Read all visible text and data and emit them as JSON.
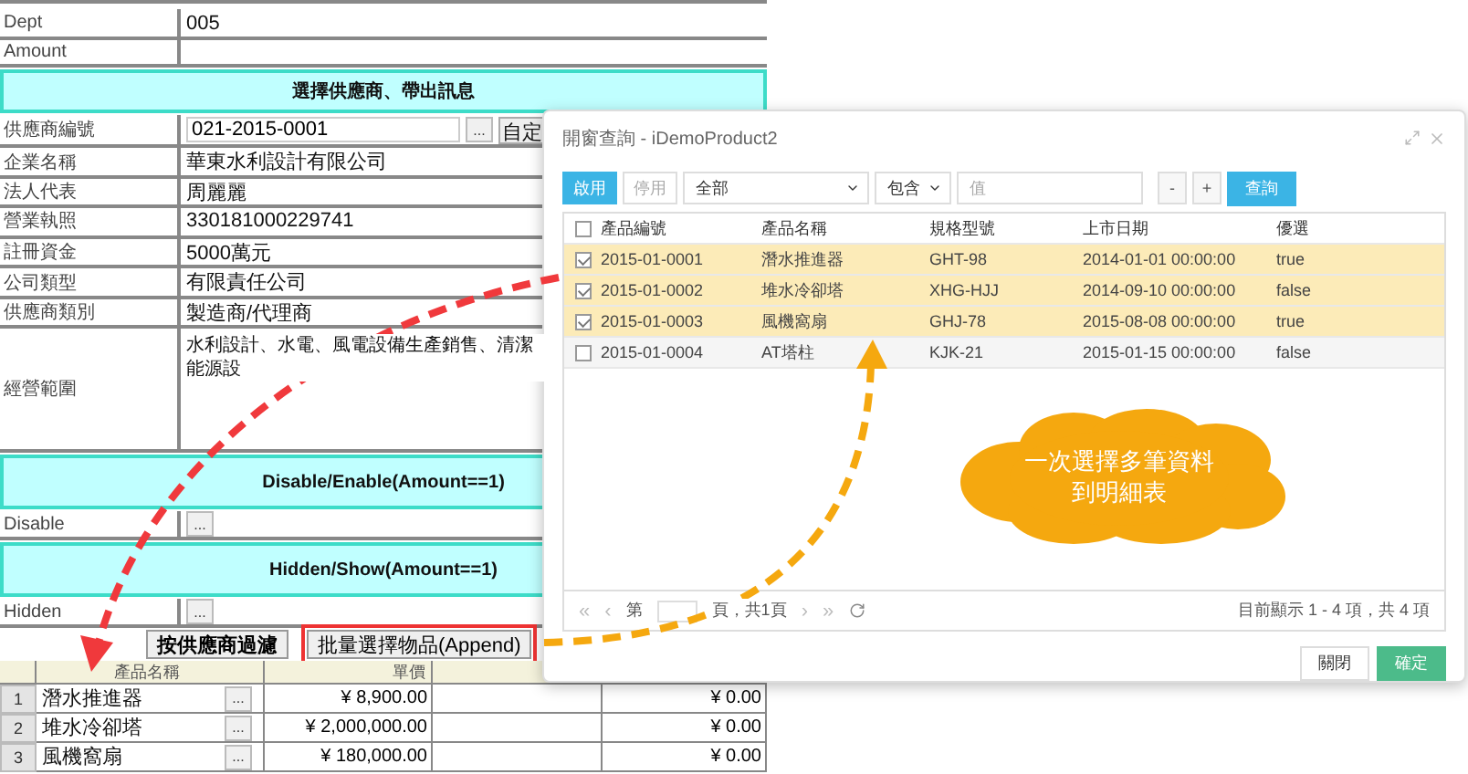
{
  "form": {
    "rows": [
      {
        "kind": "field",
        "label": "Dept",
        "value": "005"
      },
      {
        "kind": "field",
        "label": "Amount"
      },
      {
        "kind": "header",
        "title": "選擇供應商、帶出訊息"
      },
      {
        "kind": "lookup",
        "label": "供應商編號",
        "value": "021-2015-0001",
        "button": "...",
        "action": "自定"
      },
      {
        "kind": "field",
        "label": "企業名稱",
        "value": "華東水利設計有限公司"
      },
      {
        "kind": "field",
        "label": "法人代表",
        "value": "周麗麗"
      },
      {
        "kind": "field",
        "label": "營業執照",
        "value": "330181000229741"
      },
      {
        "kind": "field",
        "label": "註冊資金",
        "value": "5000萬元"
      },
      {
        "kind": "field",
        "label": "公司類型",
        "value": "有限責任公司"
      },
      {
        "kind": "field",
        "label": "供應商類別",
        "value": "製造商/代理商"
      },
      {
        "kind": "multiline",
        "label": "經營範圍",
        "value": "水利設計、水電、風電設備生產銷售、清潔能源設"
      },
      {
        "kind": "header",
        "title": "Disable/Enable(Amount==1)"
      },
      {
        "kind": "button_field",
        "label": "Disable",
        "button": "..."
      },
      {
        "kind": "header",
        "title": "Hidden/Show(Amount==1)"
      },
      {
        "kind": "button_field",
        "label": "Hidden",
        "button": "..."
      }
    ],
    "actions": [
      {
        "label": "按供應商過濾",
        "highlighted": false
      },
      {
        "label": "批量選擇物品(Append)",
        "highlighted": true
      }
    ]
  },
  "detail_grid": {
    "columns": [
      "產品名稱",
      "單價"
    ],
    "rows": [
      {
        "no": "1",
        "name": "潛水推進器",
        "button": "...",
        "price": "¥ 8,900.00",
        "column_4": "¥ 0.00"
      },
      {
        "no": "2",
        "name": "堆水冷卻塔",
        "button": "...",
        "price": "¥ 2,000,000.00",
        "column_4": "¥ 0.00"
      },
      {
        "no": "3",
        "name": "風機窩扇",
        "button": "...",
        "price": "¥ 180,000.00",
        "column_4": "¥ 0.00"
      }
    ]
  },
  "dialog": {
    "title": "開窗查詢 - iDemoProduct2",
    "toggles": [
      {
        "label": "啟用",
        "selected": true
      },
      {
        "label": "停用",
        "selected": false
      }
    ],
    "field_select": "全部",
    "operator_select": "包含",
    "value_placeholder": "值",
    "buttons": [
      "-",
      "+"
    ],
    "search_button": "查詢",
    "header_checked": false,
    "columns": [
      "產品編號",
      "產品名稱",
      "規格型號",
      "上市日期",
      "優選"
    ],
    "rows": [
      {
        "checked": true,
        "cells": [
          "2015-01-0001",
          "潛水推進器",
          "GHT-98",
          "2014-01-01 00:00:00",
          "true"
        ]
      },
      {
        "checked": true,
        "cells": [
          "2015-01-0002",
          "堆水冷卻塔",
          "XHG-HJJ",
          "2014-09-10 00:00:00",
          "false"
        ]
      },
      {
        "checked": true,
        "cells": [
          "2015-01-0003",
          "風機窩扇",
          "GHJ-78",
          "2015-08-08 00:00:00",
          "true"
        ]
      },
      {
        "checked": false,
        "cells": [
          "2015-01-0004",
          "AT塔柱",
          "KJK-21",
          "2015-01-15 00:00:00",
          "false"
        ]
      }
    ],
    "pager": {
      "first": "«",
      "prev": "‹",
      "page_prefix": "第",
      "page_suffix": "頁，共1頁",
      "next": "›",
      "last": "»",
      "summary": "目前顯示 1 - 4 項，共 4 項"
    },
    "footer": [
      {
        "label": "關閉",
        "kind": "default"
      },
      {
        "label": "確定",
        "kind": "primary"
      }
    ]
  },
  "callout": {
    "lines": [
      "一次選擇多筆資料",
      "到明細表"
    ]
  }
}
